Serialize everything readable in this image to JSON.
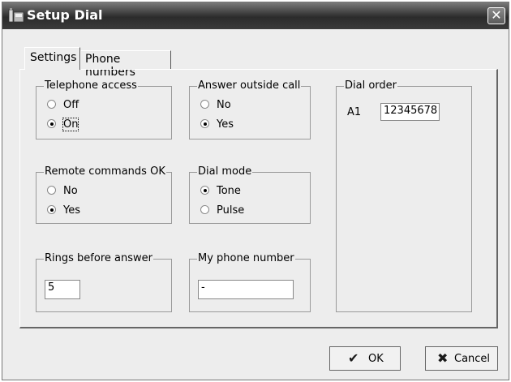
{
  "window": {
    "title": "Setup Dial",
    "close_glyph": "✕"
  },
  "tabs": [
    {
      "label": "Settings",
      "selected": true
    },
    {
      "label": "Phone numbers",
      "selected": false
    }
  ],
  "groups": {
    "telephone_access": {
      "title": "Telephone access",
      "options": [
        {
          "label": "Off",
          "checked": false
        },
        {
          "label": "On",
          "checked": true
        }
      ]
    },
    "answer_outside_call": {
      "title": "Answer outside call",
      "options": [
        {
          "label": "No",
          "checked": false
        },
        {
          "label": "Yes",
          "checked": true
        }
      ]
    },
    "remote_commands": {
      "title": "Remote commands OK",
      "options": [
        {
          "label": "No",
          "checked": false
        },
        {
          "label": "Yes",
          "checked": true
        }
      ]
    },
    "dial_mode": {
      "title": "Dial mode",
      "options": [
        {
          "label": "Tone",
          "checked": true
        },
        {
          "label": "Pulse",
          "checked": false
        }
      ]
    },
    "rings_before_answer": {
      "title": "Rings before answer",
      "value": "5"
    },
    "my_phone_number": {
      "title": "My phone number",
      "value": "-"
    },
    "dial_order": {
      "title": "Dial order",
      "entry_label": "A1",
      "entry_value": "12345678"
    }
  },
  "buttons": {
    "ok": "OK",
    "cancel": "Cancel"
  },
  "icons": {
    "window": "phone-setup-icon",
    "ok": "checkmark-icon",
    "cancel": "x-mark-icon",
    "close": "close-icon"
  }
}
